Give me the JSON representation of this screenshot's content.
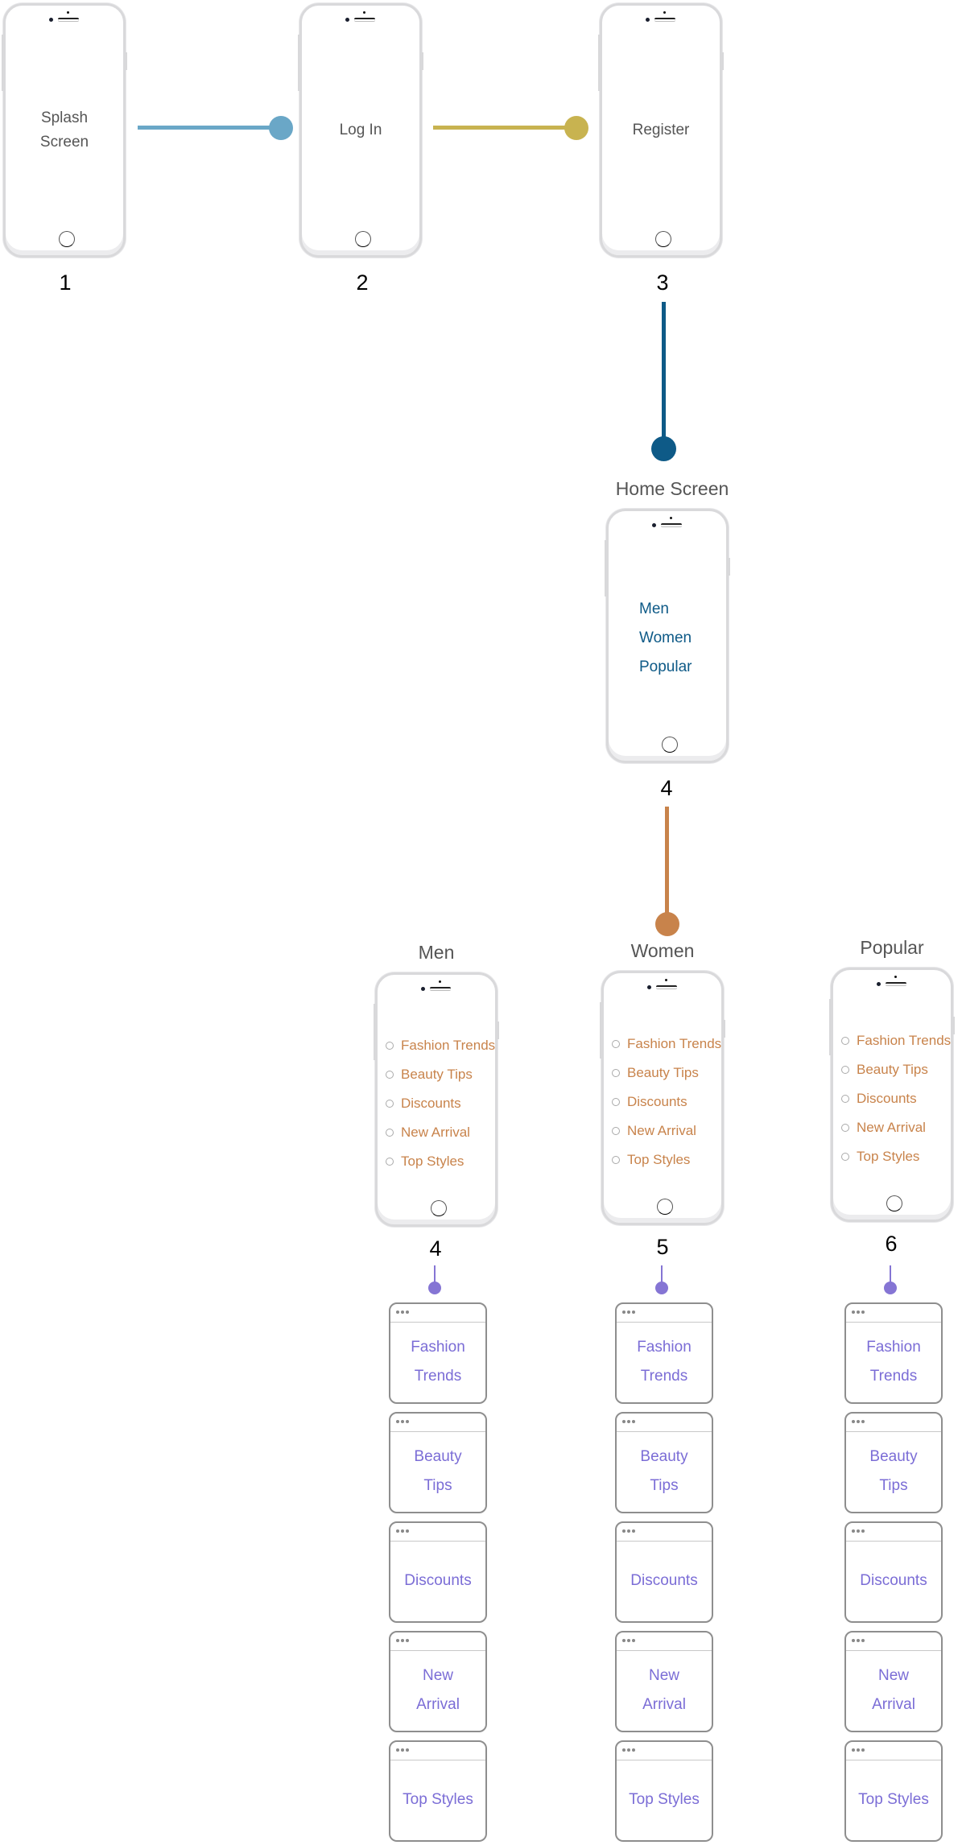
{
  "colors": {
    "splash_to_login": "#6aa7c7",
    "login_to_register": "#c8b350",
    "register_to_home": "#0e5a87",
    "home_to_categories": "#c8834b",
    "category_to_pages": "#8575d4",
    "home_menu_text": "#0e5a87",
    "category_text": "#c8834b",
    "page_text": "#7b6dd6"
  },
  "top_row": [
    {
      "screen": "Splash Screen",
      "number": "1"
    },
    {
      "screen": "Log In",
      "number": "2"
    },
    {
      "screen": "Register",
      "number": "3"
    }
  ],
  "home": {
    "title": "Home Screen",
    "number": "4",
    "menu": [
      "Men",
      "Women",
      "Popular"
    ]
  },
  "categories": [
    {
      "title": "Men",
      "number": "4",
      "items": [
        "Fashion Trends",
        "Beauty Tips",
        "Discounts",
        "New Arrival",
        "Top Styles"
      ],
      "pages": [
        "Fashion Trends",
        "Beauty Tips",
        "Discounts",
        "New Arrival",
        "Top Styles"
      ]
    },
    {
      "title": "Women",
      "number": "5",
      "items": [
        "Fashion Trends",
        "Beauty Tips",
        "Discounts",
        "New Arrival",
        "Top Styles"
      ],
      "pages": [
        "Fashion Trends",
        "Beauty Tips",
        "Discounts",
        "New Arrival",
        "Top Styles"
      ]
    },
    {
      "title": "Popular",
      "number": "6",
      "items": [
        "Fashion Trends",
        "Beauty Tips",
        "Discounts",
        "New Arrival",
        "Top Styles"
      ],
      "pages": [
        "Fashion Trends",
        "Beauty Tips",
        "Discounts",
        "New Arrival",
        "Top Styles"
      ]
    }
  ]
}
